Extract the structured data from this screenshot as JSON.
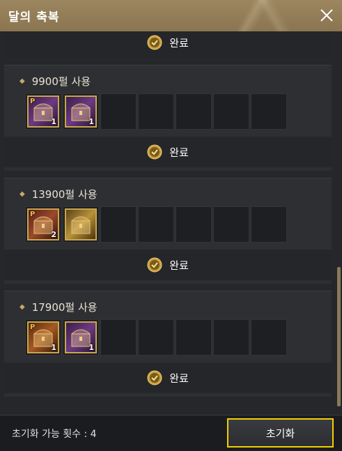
{
  "window": {
    "title": "달의 축복",
    "close_icon": "close-icon"
  },
  "top_done": {
    "label": "완료",
    "icon": "check-circle-icon"
  },
  "sections": [
    {
      "header": "9900펄 사용",
      "items": [
        {
          "icon": "premium-chest-icon",
          "tag": "P",
          "count": "1",
          "color": "purple"
        },
        {
          "icon": "purple-chest-icon",
          "tag": "",
          "count": "1",
          "color": "purple"
        }
      ],
      "empty_slots": 5,
      "done_label": "완료"
    },
    {
      "header": "13900펄 사용",
      "items": [
        {
          "icon": "premium-red-chest-icon",
          "tag": "P",
          "count": "2",
          "color": "red"
        },
        {
          "icon": "gold-ticket-icon",
          "tag": "",
          "count": "",
          "color": "gold"
        }
      ],
      "empty_slots": 5,
      "done_label": "완료"
    },
    {
      "header": "17900펄 사용",
      "items": [
        {
          "icon": "premium-orange-chest-icon",
          "tag": "P",
          "count": "1",
          "color": "orange"
        },
        {
          "icon": "purple-chest-icon",
          "tag": "",
          "count": "1",
          "color": "purple"
        }
      ],
      "empty_slots": 5,
      "done_label": "완료"
    }
  ],
  "footer": {
    "reset_count": "초기화 가능 횟수 : 4",
    "reset_button": "초기화"
  },
  "colors": {
    "title_bar": "#9c8660",
    "accent_gold": "#c9a54c",
    "button_border": "#f0d000"
  }
}
